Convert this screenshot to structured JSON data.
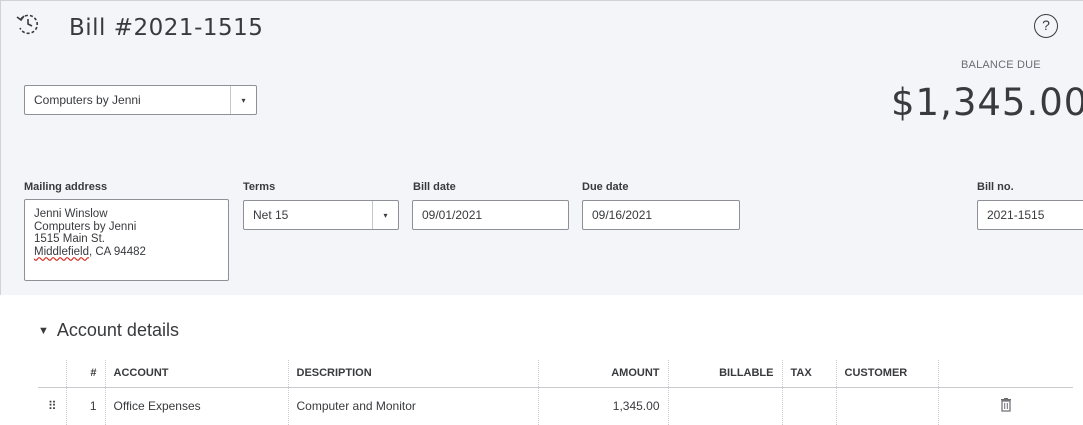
{
  "header": {
    "icon": "history-icon",
    "title": "Bill #2021-1515",
    "help_icon": "help-icon",
    "help_glyph": "?"
  },
  "balance": {
    "label": "BALANCE DUE",
    "amount": "$1,345.00"
  },
  "vendor": {
    "selected": "Computers by Jenni",
    "caret": "▾"
  },
  "fields": {
    "mailing_address_label": "Mailing address",
    "mailing_address_lines": [
      "Jenni Winslow",
      "Computers by Jenni",
      "1515 Main St.",
      "Middlefield",
      ", CA  94482"
    ],
    "terms_label": "Terms",
    "terms_value": "Net 15",
    "bill_date_label": "Bill date",
    "bill_date_value": "09/01/2021",
    "due_date_label": "Due date",
    "due_date_value": "09/16/2021",
    "bill_no_label": "Bill no.",
    "bill_no_value": "2021-1515"
  },
  "account_details": {
    "toggle_glyph": "▼",
    "title": "Account details",
    "columns": [
      "#",
      "ACCOUNT",
      "DESCRIPTION",
      "AMOUNT",
      "BILLABLE",
      "TAX",
      "CUSTOMER"
    ],
    "rows": [
      {
        "grip": "⠿",
        "num": "1",
        "account": "Office Expenses",
        "description": "Computer and Monitor",
        "amount": "1,345.00",
        "billable": "",
        "tax": "",
        "customer": "",
        "delete_icon": "trash-icon"
      }
    ]
  }
}
